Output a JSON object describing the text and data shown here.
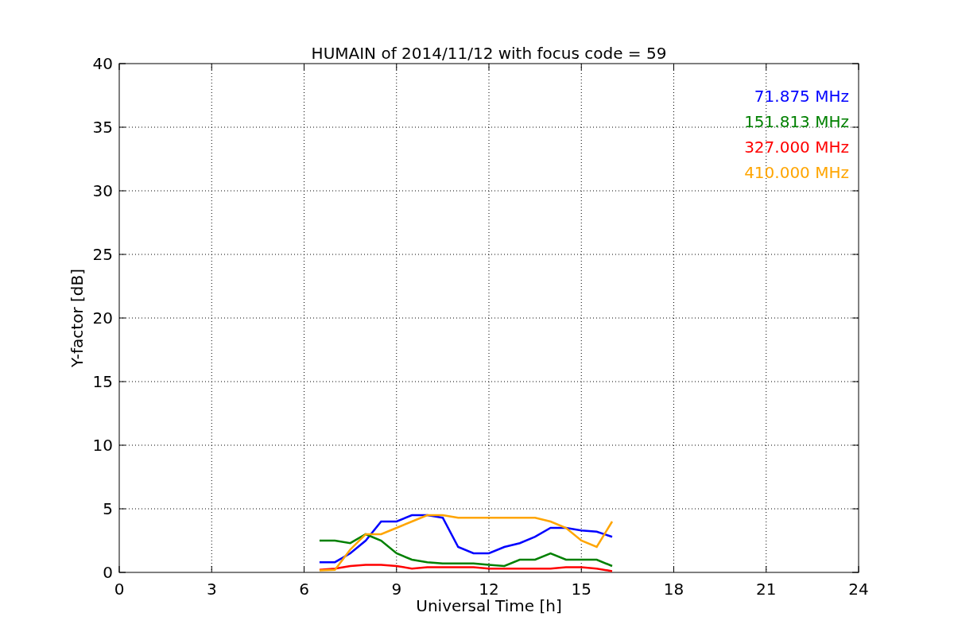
{
  "chart_data": {
    "type": "line",
    "grid": true,
    "title": "HUMAIN of 2014/11/12 with focus code = 59",
    "xlabel": "Universal Time [h]",
    "ylabel": "Y-factor [dB]",
    "xlim": [
      0,
      24
    ],
    "ylim": [
      0,
      40
    ],
    "xticks": [
      0,
      3,
      6,
      9,
      12,
      15,
      18,
      21,
      24
    ],
    "yticks": [
      0,
      5,
      10,
      15,
      20,
      25,
      30,
      35,
      40
    ],
    "x": [
      6.5,
      7,
      7.5,
      8,
      8.5,
      9,
      9.5,
      10,
      10.5,
      11,
      11.5,
      12,
      12.5,
      13,
      13.5,
      14,
      14.5,
      15,
      15.5,
      16
    ],
    "series": [
      {
        "name": "71.875 MHz",
        "color": "#0000ff",
        "values": [
          0.8,
          0.8,
          1.5,
          2.5,
          4,
          4,
          4.5,
          4.5,
          4.3,
          2,
          1.5,
          1.5,
          2,
          2.3,
          2.8,
          3.5,
          3.5,
          3.3,
          3.2,
          2.8
        ]
      },
      {
        "name": "151.813 MHz",
        "color": "#008000",
        "values": [
          2.5,
          2.5,
          2.3,
          3,
          2.5,
          1.5,
          1,
          0.8,
          0.7,
          0.7,
          0.7,
          0.6,
          0.5,
          1,
          1,
          1.5,
          1,
          1,
          1,
          0.5
        ]
      },
      {
        "name": "327.000 MHz",
        "color": "#ff0000",
        "values": [
          0.2,
          0.3,
          0.5,
          0.6,
          0.6,
          0.5,
          0.3,
          0.4,
          0.4,
          0.4,
          0.4,
          0.3,
          0.3,
          0.3,
          0.3,
          0.3,
          0.4,
          0.4,
          0.3,
          0.1
        ]
      },
      {
        "name": "410.000 MHz",
        "color": "#ffa500",
        "values": [
          0.15,
          0.2,
          1.8,
          3,
          3,
          3.5,
          4,
          4.5,
          4.5,
          4.3,
          4.3,
          4.3,
          4.3,
          4.3,
          4.3,
          4,
          3.5,
          2.5,
          2,
          4
        ]
      }
    ]
  }
}
